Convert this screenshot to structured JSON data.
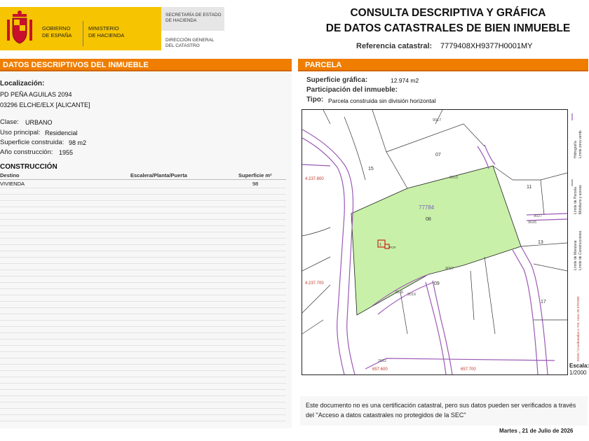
{
  "header": {
    "gobierno": [
      "GOBIERNO",
      "DE ESPAÑA"
    ],
    "ministerio": [
      "MINISTERIO",
      "DE HACIENDA"
    ],
    "secretaria": [
      "SECRETARÍA DE ESTADO",
      "DE HACIENDA"
    ],
    "direccion": [
      "DIRECCIÓN GENERAL",
      "DEL CATASTRO"
    ],
    "title_line1": "CONSULTA DESCRIPTIVA Y GRÁFICA",
    "title_line2": "DE DATOS CATASTRALES DE BIEN INMUEBLE",
    "ref_label": "Referencia catastral:",
    "ref_value": "7779408XH9377H0001MY"
  },
  "left": {
    "section_title": "DATOS DESCRIPTIVOS DEL INMUEBLE",
    "localizacion_label": "Localización:",
    "address_line1": "PD PEÑA AGUILAS 2094",
    "address_line2": "03296 ELCHE/ELX [ALICANTE]",
    "clase_label": "Clase:",
    "clase_value": "URBANO",
    "uso_label": "Uso principal:",
    "uso_value": "Residencial",
    "sup_label": "Superficie construida:",
    "sup_value": "98 m2",
    "anio_label": "Año construcción:",
    "anio_value": "1955",
    "construccion": {
      "title": "CONSTRUCCIÓN",
      "columns": [
        "Destino",
        "Escalera/Planta/Puerta",
        "Superficie m²"
      ],
      "rows": [
        [
          "VIVIENDA",
          "",
          "98"
        ]
      ]
    }
  },
  "right": {
    "section_title": "PARCELA",
    "sup_grafica_label": "Superficie gráfica:",
    "sup_grafica_value": "12.974 m2",
    "participacion_label": "Participación del inmueble:",
    "tipo_label": "Tipo:",
    "tipo_value": "Parcela construida sin división horizontal"
  },
  "map": {
    "parcel_fill": "#c8f0a8",
    "parcel_ref": "77784",
    "parcel_no": "08",
    "labels": {
      "l07": "07",
      "l15": "15",
      "l11": "11",
      "l13": "13",
      "l09": "09",
      "l17": "17",
      "n9017": "9017",
      "n9015": "9015",
      "n9007": "9007",
      "n9016": "9016",
      "n2026": "2026",
      "n9027": "9027",
      "n9026": "9026",
      "n2662": "2662",
      "y1": "4.237.800",
      "y2": "4.237.700",
      "x1": "657.600",
      "x2": "657.700",
      "bldg": "1",
      "bldg2": "PCR"
    },
    "legend": [
      "Límite de Manzana",
      "Límite de Parcela",
      "Límite de Construcciones",
      "Mobiliario y aceras",
      "Límite zona verde",
      "Hidrografía"
    ],
    "crs_text": "ED50 / Coordenadas U.T.M. Huso 30 ETRS89",
    "scale_label": "Escala:",
    "scale_value": "1/2000"
  },
  "footer": {
    "note": "Este documento no es una certificación catastral, pero sus datos pueden ser verificados a través del \"Acceso a datos catastrales no protegidos de la SEC\"",
    "date": "Martes , 21 de Julio de 2026"
  }
}
